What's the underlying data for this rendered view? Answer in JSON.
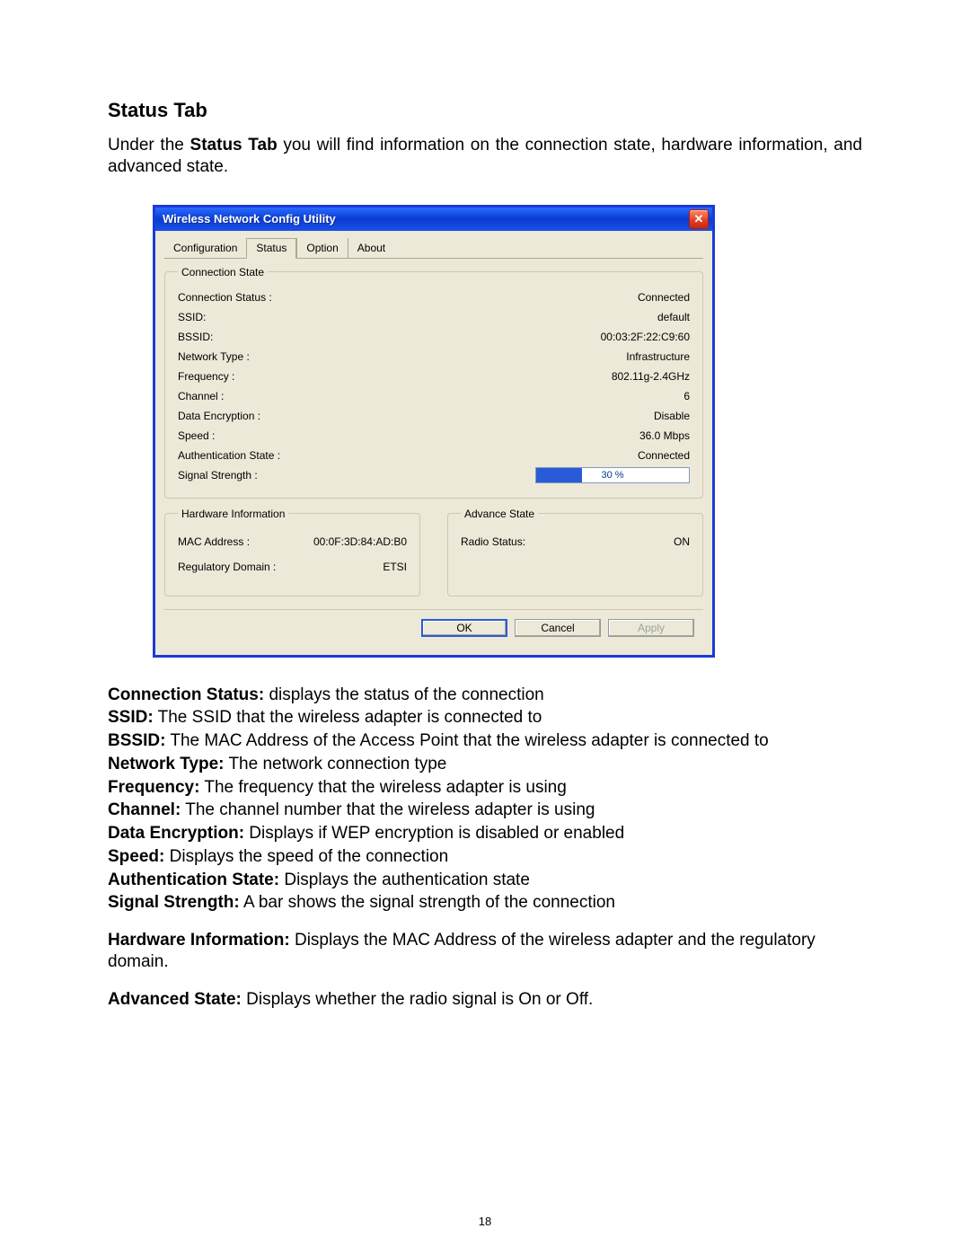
{
  "page": {
    "heading": "Status Tab",
    "intro_before": "Under the ",
    "intro_bold": "Status Tab",
    "intro_after": " you will find information on the connection state, hardware information, and advanced state.",
    "page_number": "18"
  },
  "dialog": {
    "title": "Wireless Network Config Utility",
    "tabs": {
      "configuration": "Configuration",
      "status": "Status",
      "option": "Option",
      "about": "About"
    },
    "connection_state": {
      "legend": "Connection State",
      "fields": {
        "connection_status": {
          "label": "Connection Status :",
          "value": "Connected"
        },
        "ssid": {
          "label": "SSID:",
          "value": "default"
        },
        "bssid": {
          "label": "BSSID:",
          "value": "00:03:2F:22:C9:60"
        },
        "network_type": {
          "label": "Network Type :",
          "value": "Infrastructure"
        },
        "frequency": {
          "label": "Frequency :",
          "value": "802.11g-2.4GHz"
        },
        "channel": {
          "label": "Channel :",
          "value": "6"
        },
        "data_encryption": {
          "label": "Data Encryption :",
          "value": "Disable"
        },
        "speed": {
          "label": "Speed :",
          "value": "36.0  Mbps"
        },
        "auth_state": {
          "label": "Authentication State :",
          "value": "Connected"
        },
        "signal_strength": {
          "label": "Signal Strength :",
          "percent": 30,
          "text": "30 %"
        }
      }
    },
    "hardware_info": {
      "legend": "Hardware Information",
      "mac": {
        "label": "MAC Address :",
        "value": "00:0F:3D:84:AD:B0"
      },
      "domain": {
        "label": "Regulatory Domain :",
        "value": "ETSI"
      }
    },
    "advance_state": {
      "legend": "Advance State",
      "radio": {
        "label": "Radio Status:",
        "value": "ON"
      }
    },
    "buttons": {
      "ok": "OK",
      "cancel": "Cancel",
      "apply": "Apply"
    }
  },
  "definitions": {
    "conn_status": {
      "term": "Connection Status:",
      "desc": " displays the status of the connection"
    },
    "ssid": {
      "term": "SSID:",
      "desc": " The SSID that the wireless adapter is connected to"
    },
    "bssid": {
      "term": "BSSID:",
      "desc": " The MAC Address of the Access Point that the wireless adapter is connected to"
    },
    "network_type": {
      "term": "Network Type:",
      "desc": " The network connection type"
    },
    "frequency": {
      "term": "Frequency:",
      "desc": " The frequency that the wireless adapter is using"
    },
    "channel": {
      "term": "Channel:",
      "desc": " The channel number that the wireless adapter is using"
    },
    "data_enc": {
      "term": "Data Encryption:",
      "desc": " Displays if WEP encryption is disabled or enabled"
    },
    "speed": {
      "term": "Speed:",
      "desc": " Displays the speed of the connection"
    },
    "auth_state": {
      "term": "Authentication State:",
      "desc": " Displays the authentication state"
    },
    "signal": {
      "term": "Signal Strength:",
      "desc": " A bar shows the signal strength of the connection"
    },
    "hw_info": {
      "term": "Hardware Information:",
      "desc": " Displays the MAC Address of the wireless adapter and the regulatory domain."
    },
    "adv_state": {
      "term": "Advanced State:",
      "desc": " Displays whether the radio signal is On or Off."
    }
  }
}
